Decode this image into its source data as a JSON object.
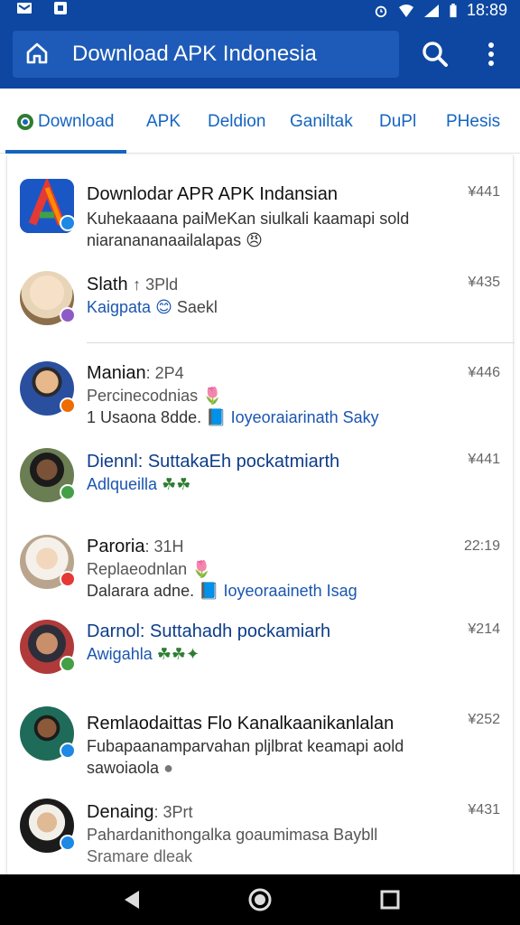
{
  "status": {
    "time": "18:89"
  },
  "appbar": {
    "title": "Download APK Indonesia"
  },
  "tabs": [
    "Download",
    "APK",
    "Deldion",
    "Ganiltak",
    "DuPl",
    "PHesis"
  ],
  "items": [
    {
      "name": "Downlodar APR APK Indansian",
      "sub": "",
      "line2": "Kuhekaaana paiMeKan siulkali kaamapi sold",
      "line3a": "niaranananaailalapas",
      "line3b": "",
      "time": "¥441"
    },
    {
      "name": "Slath",
      "sub": "↑ 3Pld",
      "line2": "Kaigpata",
      "line2b": "Saekl",
      "line3a": "",
      "line3b": "",
      "time": "¥435"
    },
    {
      "name": "Manian",
      "sub": ": 2P4",
      "line2": "Percinecodnias",
      "line3a": "1 Usaona 8dde.",
      "line3b": "Ioyeoraiarinath Saky",
      "time": "¥446"
    },
    {
      "name": "Diennl: SuttakaEh pockatmiarth",
      "sub": "",
      "line2": "Adlqueilla",
      "line3a": "",
      "line3b": "",
      "time": "¥441"
    },
    {
      "name": "Paroria",
      "sub": ": 31H",
      "line2": "Replaeodnlan",
      "line3a": "Dalarara adne.",
      "line3b": "Ioyeoraaineth Isag",
      "time": "22:19"
    },
    {
      "name": "Darnol: Suttahadh pockamiarh",
      "sub": "",
      "line2": "Awigahla",
      "line3a": "",
      "line3b": "",
      "time": "¥214"
    },
    {
      "name": "Remlaodaittas Flo Kanalkaanikanlalan",
      "sub": "",
      "line2": "Fubapaanamparvahan pljlbrat keamapi aold",
      "line3a": "sawoiaola",
      "line3b": "",
      "time": "¥252"
    },
    {
      "name": "Denaing",
      "sub": ": 3Prt",
      "line2": "Pahardanithongalka goaumimasa Baybll",
      "line3a": "Sramare dleak",
      "line3b": "",
      "time": "¥431"
    }
  ],
  "colors": {
    "primary": "#0d47a1",
    "accent": "#1565c0"
  }
}
